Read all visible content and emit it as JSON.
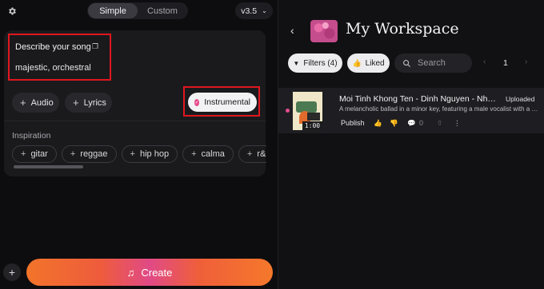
{
  "left": {
    "mode_tabs": [
      {
        "label": "Simple",
        "active": true
      },
      {
        "label": "Custom",
        "active": false
      }
    ],
    "version": "v3.5",
    "prompt": {
      "title": "Describe your song",
      "value": "majestic, orchestral"
    },
    "buttons": {
      "audio": "Audio",
      "lyrics": "Lyrics",
      "instrumental": "Instrumental"
    },
    "inspiration": {
      "label": "Inspiration",
      "tags": [
        "gitar",
        "reggae",
        "hip hop",
        "calma",
        "r&b",
        ""
      ]
    },
    "create_label": "Create"
  },
  "right": {
    "title": "My Workspace",
    "filters_label": "Filters (4)",
    "liked_label": "Liked",
    "search_placeholder": "Search",
    "page": "1",
    "song": {
      "title": "Moi Tinh Khong Ten - Dinh Nguyen - NhacHa...",
      "badge": "Uploaded",
      "description": "A melancholic ballad in a minor key, featuring a male vocalist with a clear,",
      "duration": "1:00",
      "publish_label": "Publish",
      "comments": "0"
    }
  },
  "colors": {
    "accent_pink": "#e64c8e",
    "create_orange": "#f2742a",
    "highlight_red": "#e0161e"
  }
}
